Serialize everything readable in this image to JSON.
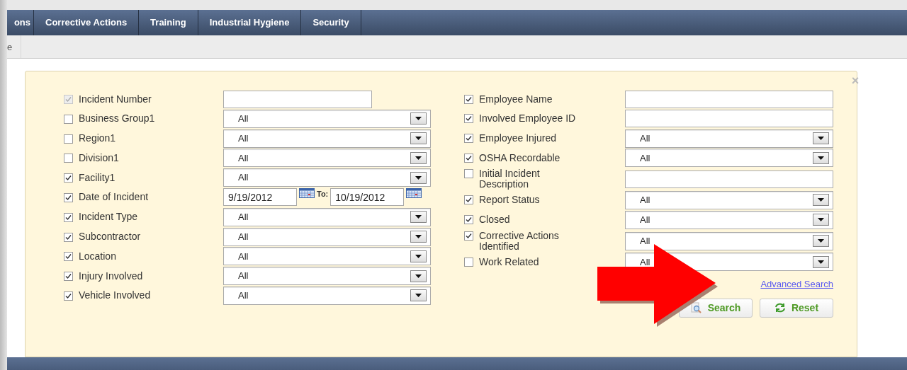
{
  "nav_tabs": [
    {
      "label": "ons"
    },
    {
      "label": "Corrective Actions"
    },
    {
      "label": "Training"
    },
    {
      "label": "Industrial Hygiene"
    },
    {
      "label": "Security"
    }
  ],
  "sub_bar": {
    "label": "e"
  },
  "panel": {
    "close": "×",
    "left_fields": [
      {
        "label": "Incident Number",
        "checked": true,
        "disabled": true,
        "kind": "text"
      },
      {
        "label": "Business Group1",
        "checked": false,
        "disabled": false,
        "kind": "select",
        "value": "All"
      },
      {
        "label": "Region1",
        "checked": false,
        "disabled": false,
        "kind": "select",
        "value": "All"
      },
      {
        "label": "Division1",
        "checked": false,
        "disabled": false,
        "kind": "select",
        "value": "All"
      },
      {
        "label": "Facility1",
        "checked": true,
        "disabled": false,
        "kind": "select",
        "value": "All"
      },
      {
        "label": "Date of Incident",
        "checked": true,
        "disabled": false,
        "kind": "date_range",
        "from": "9/19/2012",
        "separator": "To:",
        "to": "10/19/2012"
      },
      {
        "label": "Incident Type",
        "checked": true,
        "disabled": false,
        "kind": "select",
        "value": "All"
      },
      {
        "label": "Subcontractor",
        "checked": true,
        "disabled": false,
        "kind": "select",
        "value": "All"
      },
      {
        "label": "Location",
        "checked": true,
        "disabled": false,
        "kind": "select",
        "value": "All"
      },
      {
        "label": "Injury Involved",
        "checked": true,
        "disabled": false,
        "kind": "select",
        "value": "All"
      },
      {
        "label": "Vehicle Involved",
        "checked": true,
        "disabled": false,
        "kind": "select",
        "value": "All"
      }
    ],
    "right_fields": [
      {
        "label": "Employee Name",
        "checked": true,
        "kind": "text"
      },
      {
        "label": "Involved Employee ID",
        "checked": true,
        "kind": "text"
      },
      {
        "label": "Employee Injured",
        "checked": true,
        "kind": "select",
        "value": "All"
      },
      {
        "label": "OSHA Recordable",
        "checked": true,
        "kind": "select",
        "value": "All"
      },
      {
        "label": "Initial Incident Description",
        "checked": false,
        "kind": "text"
      },
      {
        "label": "Report Status",
        "checked": true,
        "kind": "select",
        "value": "All"
      },
      {
        "label": "Closed",
        "checked": true,
        "kind": "select",
        "value": "All"
      },
      {
        "label": "Corrective Actions Identified",
        "checked": true,
        "kind": "select",
        "value": "All"
      },
      {
        "label": "Work Related",
        "checked": false,
        "kind": "select",
        "value": "All"
      }
    ],
    "advanced_link": "Advanced Search",
    "buttons": [
      {
        "label": "Search",
        "kind": "search"
      },
      {
        "label": "Reset",
        "kind": "reset"
      }
    ]
  }
}
